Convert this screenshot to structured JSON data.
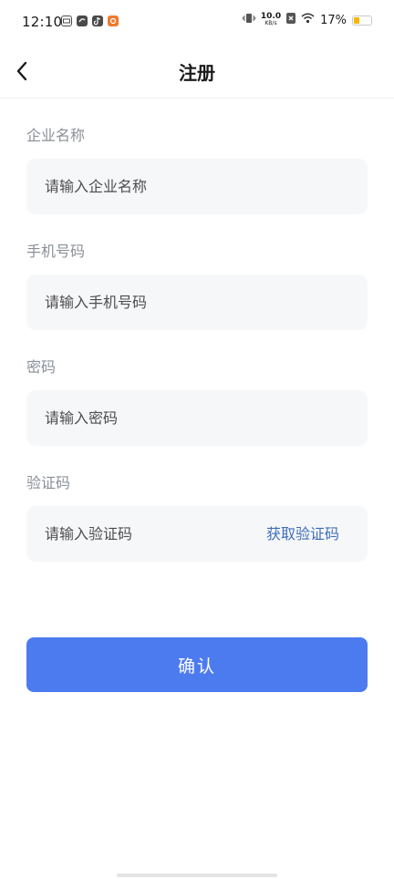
{
  "status_bar": {
    "time": "12:10",
    "net_speed_value": "10.0",
    "net_speed_unit": "KB/s",
    "battery_percent": "17%",
    "battery_level": 0.17,
    "icons": [
      "notification-box-icon",
      "app-loop-icon",
      "tiktok-icon",
      "taobao-icon",
      "vibrate-icon",
      "sim-x-icon",
      "wifi-icon",
      "battery-icon"
    ]
  },
  "header": {
    "back_icon": "chevron-left-icon",
    "title": "注册"
  },
  "form": {
    "company": {
      "label": "企业名称",
      "placeholder": "请输入企业名称",
      "value": ""
    },
    "phone": {
      "label": "手机号码",
      "placeholder": "请输入手机号码",
      "value": ""
    },
    "password": {
      "label": "密码",
      "placeholder": "请输入密码",
      "value": ""
    },
    "code": {
      "label": "验证码",
      "placeholder": "请输入验证码",
      "value": "",
      "get_code_label": "获取验证码"
    }
  },
  "confirm_label": "确认",
  "colors": {
    "accent": "#4c7bf0",
    "link": "#3f6fb8",
    "label": "#8a8f99",
    "field_bg": "#f6f7f9",
    "battery": "#f2b705"
  }
}
